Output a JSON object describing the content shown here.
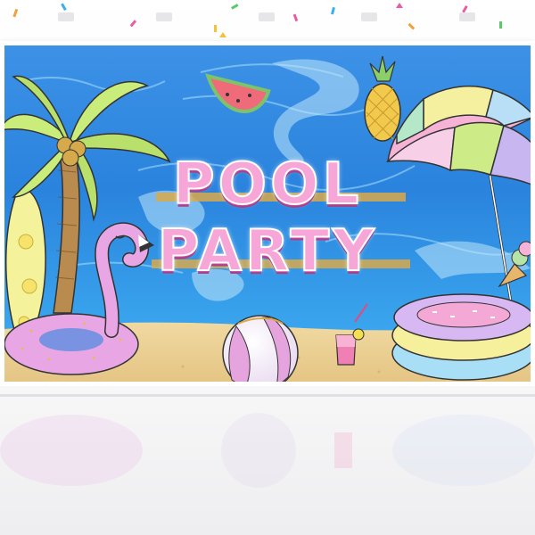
{
  "banner": {
    "title_line_1": "POOL",
    "title_line_2": "PARTY"
  },
  "colors": {
    "water": "#2f86e0",
    "water_light": "#7cc8f5",
    "sand": "#e9cf93",
    "title_pink": "#f7a6d8",
    "glitter_gold": "#d8a94a"
  },
  "icons": [
    "palm-tree-icon",
    "surfboard-icon",
    "flamingo-float-icon",
    "watermelon-icon",
    "pineapple-icon",
    "beach-umbrella-icon",
    "ice-cream-icon",
    "beach-ball-icon",
    "cocktail-icon",
    "kiddie-pool-icon"
  ]
}
